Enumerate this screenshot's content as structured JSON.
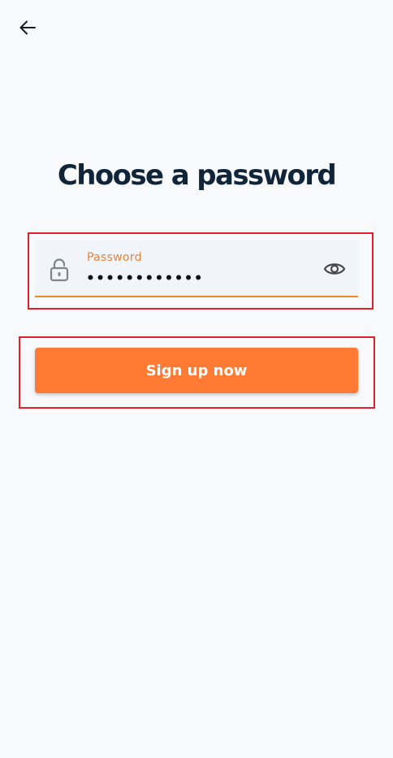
{
  "header": {
    "back_icon": "arrow-left-icon"
  },
  "main": {
    "title": "Choose a password"
  },
  "password_field": {
    "label": "Password",
    "value": "••••••••••••",
    "lock_icon": "lock-icon",
    "visibility_icon": "eye-icon"
  },
  "actions": {
    "signup_label": "Sign up now"
  },
  "colors": {
    "accent": "#FF7A33",
    "label_accent": "#E8833A",
    "title": "#10253A",
    "highlight": "#E0202A",
    "background": "#F8F9FA"
  }
}
